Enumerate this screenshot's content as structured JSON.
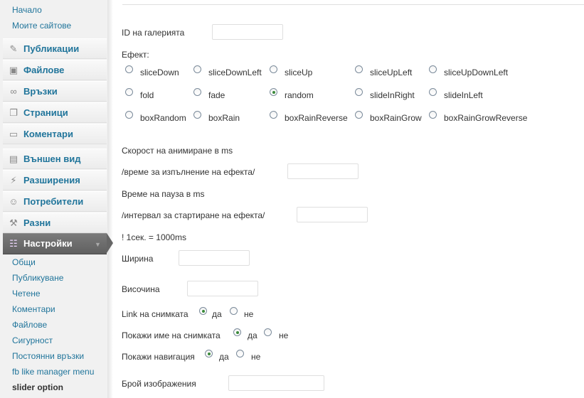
{
  "sidebar": {
    "top_links": [
      "Начало",
      "Моите сайтове"
    ],
    "menu": [
      {
        "label": "Публикации",
        "icon": "pin-icon"
      },
      {
        "label": "Файлове",
        "icon": "media-icon"
      },
      {
        "label": "Връзки",
        "icon": "links-icon"
      },
      {
        "label": "Страници",
        "icon": "pages-icon"
      },
      {
        "label": "Коментари",
        "icon": "comments-icon"
      },
      {
        "label": "Външен вид",
        "icon": "appearance-icon"
      },
      {
        "label": "Разширения",
        "icon": "plugins-icon"
      },
      {
        "label": "Потребители",
        "icon": "users-icon"
      },
      {
        "label": "Разни",
        "icon": "tools-icon"
      },
      {
        "label": "Настройки",
        "icon": "settings-icon"
      }
    ],
    "settings_submenu": [
      "Общи",
      "Публикуване",
      "Четене",
      "Коментари",
      "Файлове",
      "Сигурност",
      "Постоянни връзки",
      "fb like manager menu",
      "slider option"
    ]
  },
  "form": {
    "gallery_id_label": "ID на галерията",
    "gallery_id_value": "",
    "effect_label": "Ефект:",
    "effects": [
      [
        "sliceDown",
        "sliceDownLeft",
        "sliceUp",
        "sliceUpLeft",
        "sliceUpDownLeft"
      ],
      [
        "fold",
        "fade",
        "random",
        "slideInRight",
        "slideInLeft"
      ],
      [
        "boxRandom",
        "boxRain",
        "boxRainReverse",
        "boxRainGrow",
        "boxRainGrowReverse"
      ]
    ],
    "selected_effect": "random",
    "anim_speed_label": "Скорост на анимиране в ms",
    "anim_speed_sub": "/време за изпълнение на ефекта/",
    "anim_speed_value": "",
    "pause_label": "Време на пауза в ms",
    "pause_sub": "/интервал за стартиране на ефекта/",
    "pause_value": "",
    "note": "! 1сек. = 1000ms",
    "width_label": "Ширина",
    "width_value": "",
    "height_label": "Височина",
    "height_value": "",
    "link_label": "Link на снимката",
    "show_name_label": "Покажи име на снимката",
    "show_nav_label": "Покажи навигация",
    "yes": "да",
    "no": "не",
    "link_selected": "yes",
    "show_name_selected": "yes",
    "show_nav_selected": "yes",
    "image_count_label": "Брой изображения",
    "image_count_value": ""
  }
}
